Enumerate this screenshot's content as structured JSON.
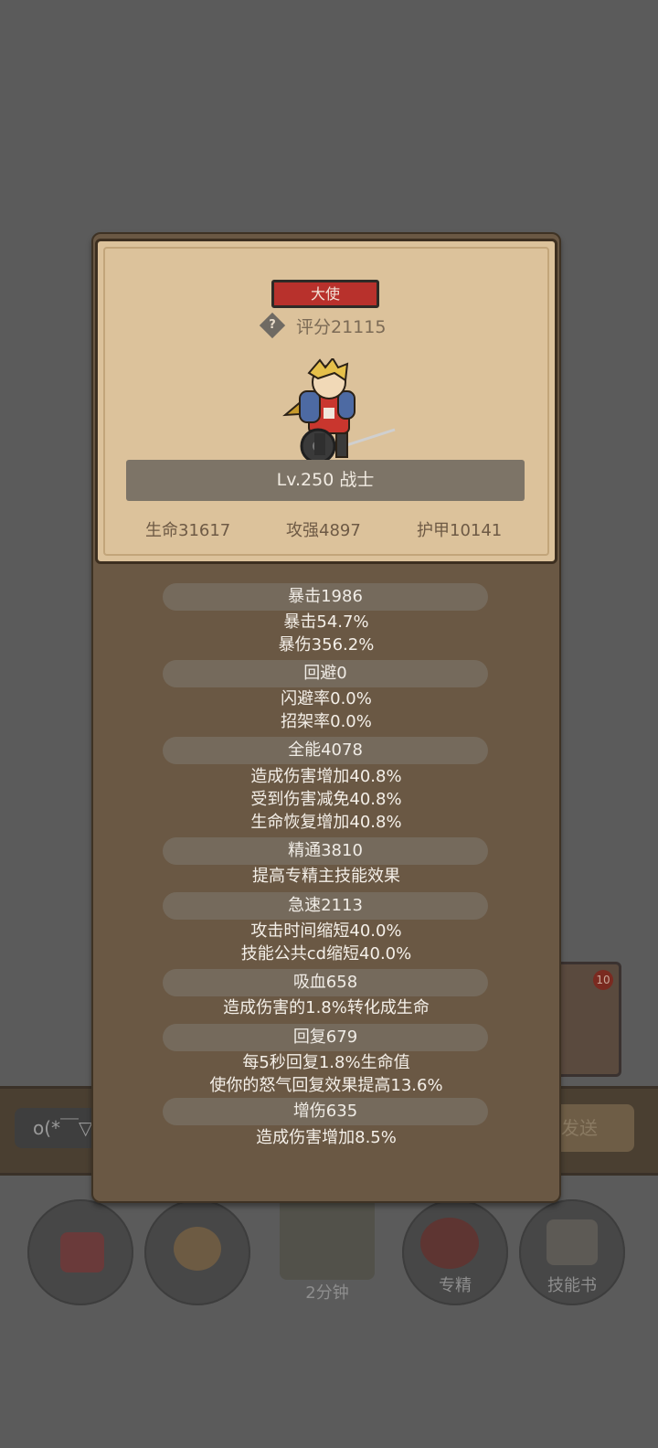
{
  "background": {
    "chat_input": "o(*￣▽",
    "send_button": "发送",
    "card_badge": "10",
    "buttons": [
      {
        "label": "",
        "icon": "potion-icon"
      },
      {
        "label": "",
        "icon": "bread-icon"
      },
      {
        "label": "2分钟",
        "icon": "chest-icon"
      },
      {
        "label": "专精",
        "icon": "specialization-icon"
      },
      {
        "label": "技能书",
        "icon": "skill-book-icon"
      }
    ]
  },
  "hero": {
    "title_badge": "大使",
    "help_icon": "?",
    "score": "评分21115",
    "level_class": "Lv.250 战士",
    "stats": {
      "hp": "生命31617",
      "attack": "攻强4897",
      "armor": "护甲10141"
    }
  },
  "attributes": [
    {
      "head": "暴击1986",
      "lines": [
        "暴击54.7%",
        "暴伤356.2%"
      ]
    },
    {
      "head": "回避0",
      "lines": [
        "闪避率0.0%",
        "招架率0.0%"
      ]
    },
    {
      "head": "全能4078",
      "lines": [
        "造成伤害增加40.8%",
        "受到伤害减免40.8%",
        "生命恢复增加40.8%"
      ]
    },
    {
      "head": "精通3810",
      "lines": [
        "提高专精主技能效果"
      ]
    },
    {
      "head": "急速2113",
      "lines": [
        "攻击时间缩短40.0%",
        "技能公共cd缩短40.0%"
      ]
    },
    {
      "head": "吸血658",
      "lines": [
        "造成伤害的1.8%转化成生命"
      ]
    },
    {
      "head": "回复679",
      "lines": [
        "每5秒回复1.8%生命值",
        "使你的怒气回复效果提高13.6%"
      ]
    },
    {
      "head": "增伤635",
      "lines": [
        "造成伤害增加8.5%"
      ]
    }
  ],
  "colors": {
    "title_badge": "#b8312c",
    "card": "#dcc29b",
    "panel": "#6a5844"
  }
}
